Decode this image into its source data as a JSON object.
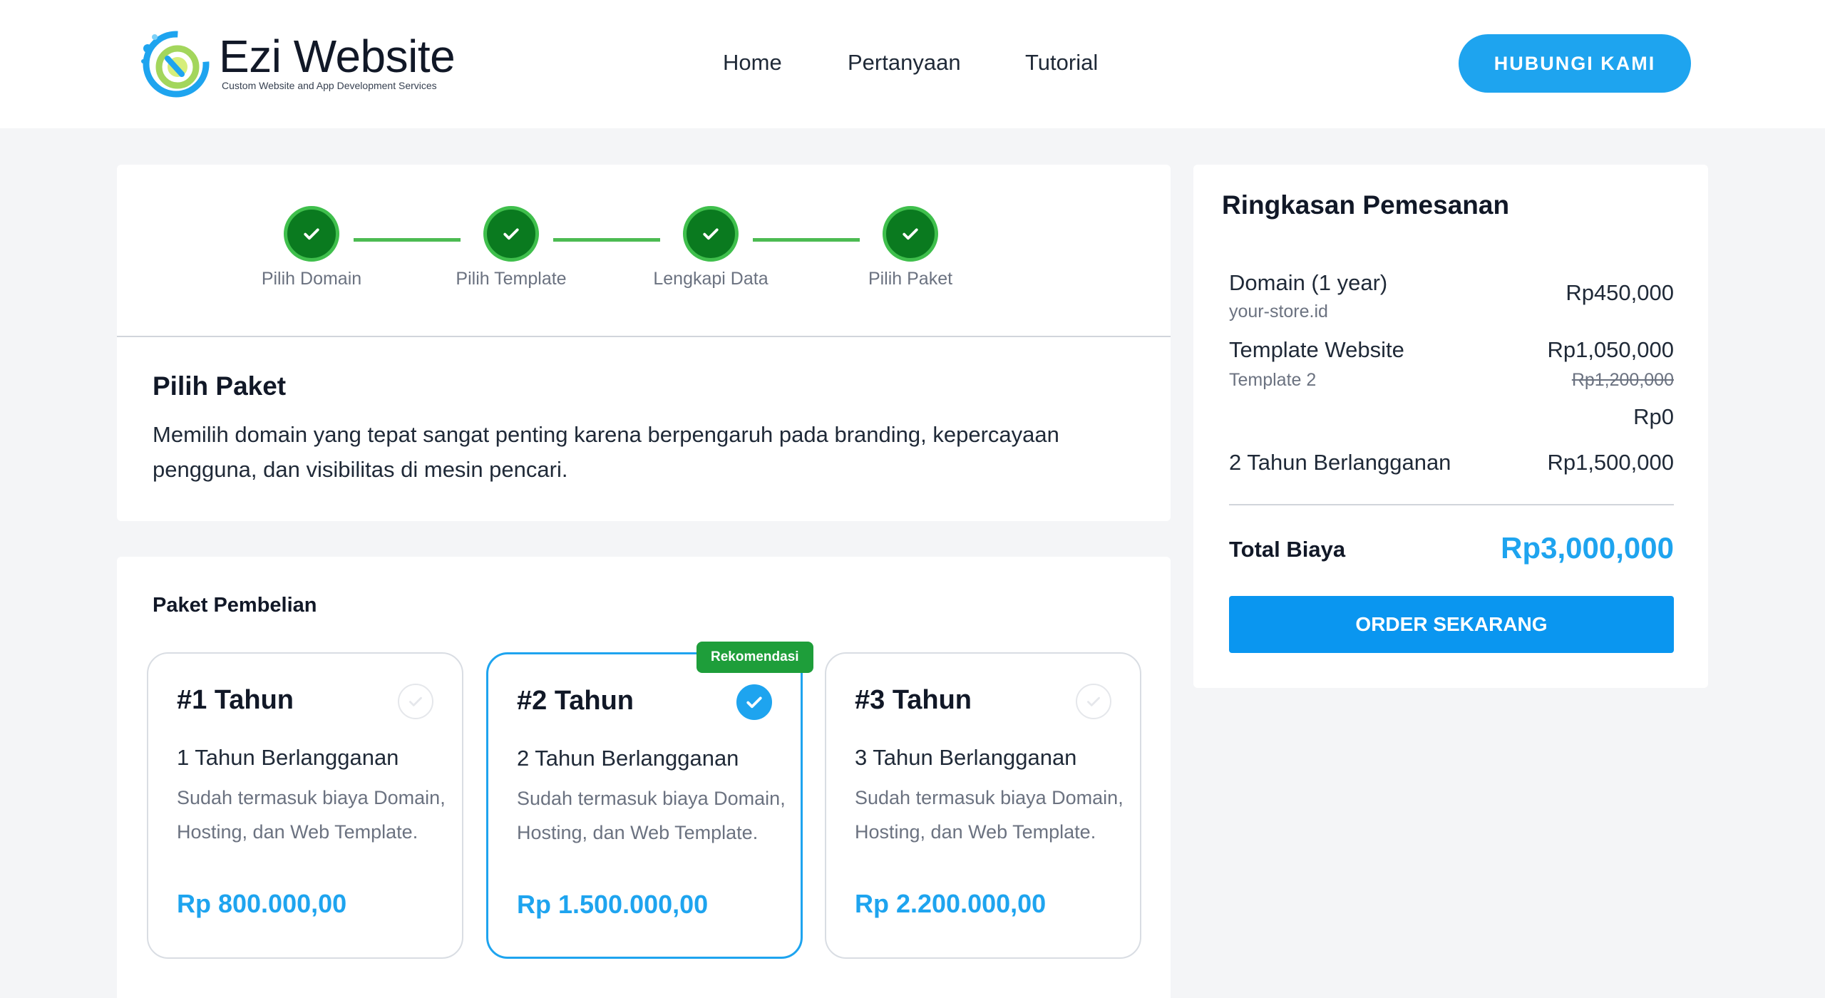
{
  "header": {
    "brand_name": "Ezi Website",
    "brand_tagline": "Custom Website and App Development Services",
    "nav": [
      {
        "label": "Home"
      },
      {
        "label": "Pertanyaan"
      },
      {
        "label": "Tutorial"
      }
    ],
    "cta_label": "HUBUNGI KAMI"
  },
  "steps": [
    {
      "label": "Pilih Domain",
      "status": "completed"
    },
    {
      "label": "Pilih Template",
      "status": "completed"
    },
    {
      "label": "Lengkapi Data",
      "status": "completed"
    },
    {
      "label": "Pilih Paket",
      "status": "completed"
    }
  ],
  "section": {
    "title": "Pilih Paket",
    "description": "Memilih domain yang tepat sangat penting karena berpengaruh pada branding, kepercayaan pengguna, dan visibilitas di mesin pencari."
  },
  "paket": {
    "title": "Paket Pembelian",
    "badge": "Rekomendasi",
    "plans": [
      {
        "name": "#1 Tahun",
        "subtitle": "1 Tahun Berlangganan",
        "description": "Sudah termasuk biaya Domain, Hosting, dan Web Template.",
        "price": "Rp 800.000,00",
        "selected": false
      },
      {
        "name": "#2 Tahun",
        "subtitle": "2 Tahun Berlangganan",
        "description": "Sudah termasuk biaya Domain, Hosting, dan Web Template.",
        "price": "Rp 1.500.000,00",
        "selected": true
      },
      {
        "name": "#3 Tahun",
        "subtitle": "3 Tahun Berlangganan",
        "description": "Sudah termasuk biaya Domain, Hosting, dan Web Template.",
        "price": "Rp 2.200.000,00",
        "selected": false
      }
    ]
  },
  "summary": {
    "title": "Ringkasan Pemesanan",
    "domain_label": "Domain (1 year)",
    "domain_sub": "your-store.id",
    "domain_price": "Rp450,000",
    "template_label": "Template Website",
    "template_sub": "Template 2",
    "template_price": "Rp1,050,000",
    "template_original_price": "Rp1,200,000",
    "extra_price": "Rp0",
    "subscription_label": "2 Tahun Berlangganan",
    "subscription_price": "Rp1,500,000",
    "total_label": "Total Biaya",
    "total_value": "Rp3,000,000",
    "order_button": "ORDER SEKARANG"
  },
  "colors": {
    "accent": "#1ea4ef",
    "step_done": "#0a7a1f",
    "badge": "#1e9e3a"
  }
}
